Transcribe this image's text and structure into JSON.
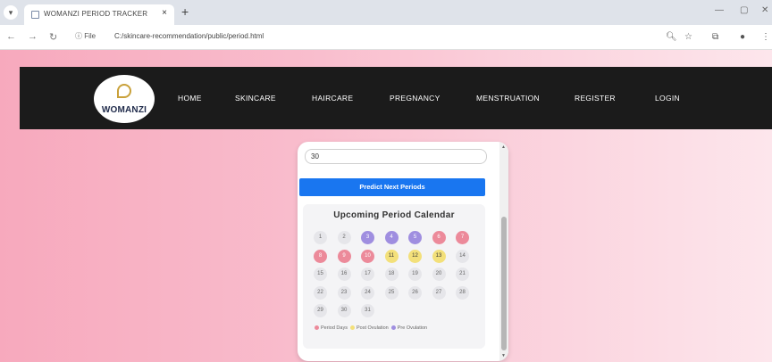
{
  "browser": {
    "tab_title": "WOMANZI PERIOD TRACKER",
    "tab_close": "×",
    "new_tab": "+",
    "file_label": "ⓘ File",
    "url": "C:/skincare-recommendation/public/period.html"
  },
  "navbar": {
    "logo_text": "WOMANZI",
    "links": [
      "HOME",
      "SKINCARE",
      "HAIRCARE",
      "PREGNANCY",
      "MENSTRUATION",
      "REGISTER",
      "LOGIN"
    ]
  },
  "tracker": {
    "cycle_length_value": "30",
    "predict_button": "Predict Next Periods",
    "calendar_title": "Upcoming Period Calendar",
    "days": [
      {
        "n": "1",
        "type": "normal"
      },
      {
        "n": "2",
        "type": "normal"
      },
      {
        "n": "3",
        "type": "pre"
      },
      {
        "n": "4",
        "type": "pre"
      },
      {
        "n": "5",
        "type": "pre"
      },
      {
        "n": "6",
        "type": "period"
      },
      {
        "n": "7",
        "type": "period"
      },
      {
        "n": "8",
        "type": "period"
      },
      {
        "n": "9",
        "type": "period"
      },
      {
        "n": "10",
        "type": "period"
      },
      {
        "n": "11",
        "type": "post"
      },
      {
        "n": "12",
        "type": "post"
      },
      {
        "n": "13",
        "type": "post"
      },
      {
        "n": "14",
        "type": "normal"
      },
      {
        "n": "15",
        "type": "normal"
      },
      {
        "n": "16",
        "type": "normal"
      },
      {
        "n": "17",
        "type": "normal"
      },
      {
        "n": "18",
        "type": "normal"
      },
      {
        "n": "19",
        "type": "normal"
      },
      {
        "n": "20",
        "type": "normal"
      },
      {
        "n": "21",
        "type": "normal"
      },
      {
        "n": "22",
        "type": "normal"
      },
      {
        "n": "23",
        "type": "normal"
      },
      {
        "n": "24",
        "type": "normal"
      },
      {
        "n": "25",
        "type": "normal"
      },
      {
        "n": "26",
        "type": "normal"
      },
      {
        "n": "27",
        "type": "normal"
      },
      {
        "n": "28",
        "type": "normal"
      },
      {
        "n": "29",
        "type": "normal"
      },
      {
        "n": "30",
        "type": "normal"
      },
      {
        "n": "31",
        "type": "normal"
      }
    ],
    "legend": {
      "period_label": "Period Days",
      "post_label": "Post Ovulation",
      "pre_label": "Pre Ovulation"
    }
  },
  "colors": {
    "period": "#ec8a9a",
    "pre_ovulation": "#9f8ee0",
    "post_ovulation": "#f3e07a",
    "button": "#1976f0",
    "navbar": "#1b1b1b"
  }
}
